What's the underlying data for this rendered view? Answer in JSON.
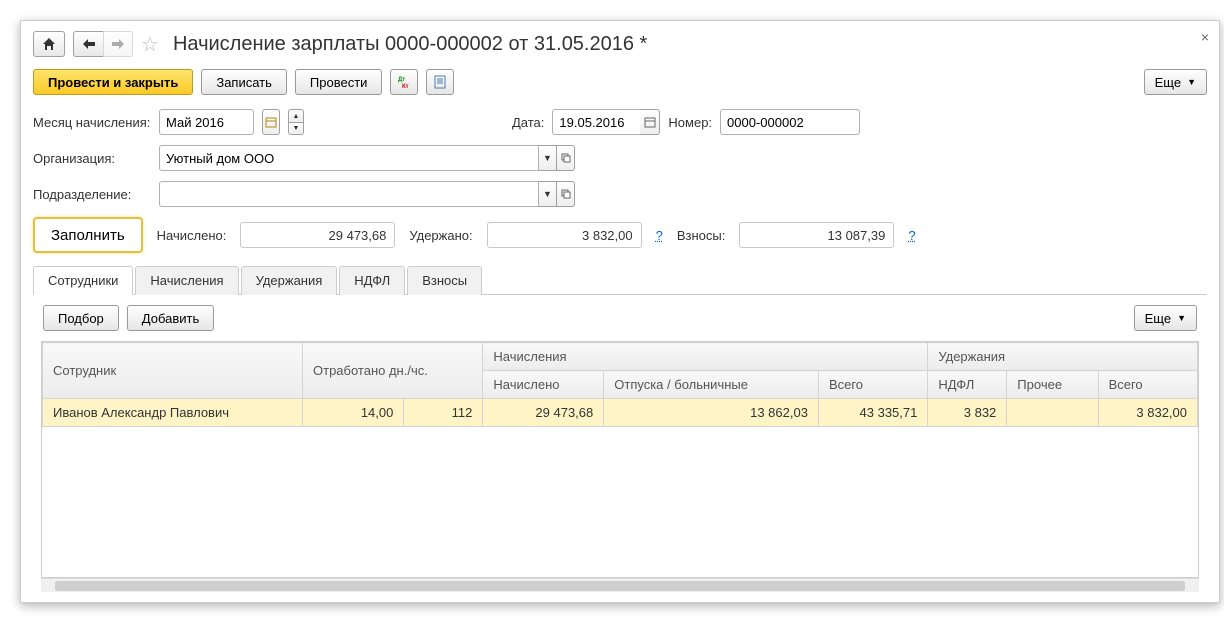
{
  "title": "Начисление зарплаты 0000-000002 от 31.05.2016 *",
  "toolbar": {
    "post_close": "Провести и закрыть",
    "save": "Записать",
    "post": "Провести",
    "more": "Еще"
  },
  "fields": {
    "month_label": "Месяц начисления:",
    "month_value": "Май 2016",
    "date_label": "Дата:",
    "date_value": "19.05.2016",
    "number_label": "Номер:",
    "number_value": "0000-000002",
    "org_label": "Организация:",
    "org_value": "Уютный дом ООО",
    "dep_label": "Подразделение:",
    "dep_value": ""
  },
  "summary": {
    "fill": "Заполнить",
    "accrued_label": "Начислено:",
    "accrued_value": "29 473,68",
    "withheld_label": "Удержано:",
    "withheld_value": "3 832,00",
    "contrib_label": "Взносы:",
    "contrib_value": "13 087,39",
    "q": "?"
  },
  "tabs": {
    "employees": "Сотрудники",
    "accruals": "Начисления",
    "withholdings": "Удержания",
    "ndfl": "НДФЛ",
    "contrib": "Взносы"
  },
  "tab_toolbar": {
    "select": "Подбор",
    "add": "Добавить",
    "more": "Еще"
  },
  "table": {
    "headers": {
      "employee": "Сотрудник",
      "worked": "Отработано дн./чс.",
      "accruals_group": "Начисления",
      "accrued": "Начислено",
      "vacation": "Отпуска / больничные",
      "total_acc": "Всего",
      "withhold_group": "Удержания",
      "ndfl": "НДФЛ",
      "other": "Прочее",
      "total_wh": "Всего"
    },
    "rows": [
      {
        "employee": "Иванов Александр Павлович",
        "days": "14,00",
        "hours": "112",
        "accrued": "29 473,68",
        "vacation": "13 862,03",
        "total_acc": "43 335,71",
        "ndfl": "3 832",
        "other": "",
        "total_wh": "3 832,00"
      }
    ]
  }
}
